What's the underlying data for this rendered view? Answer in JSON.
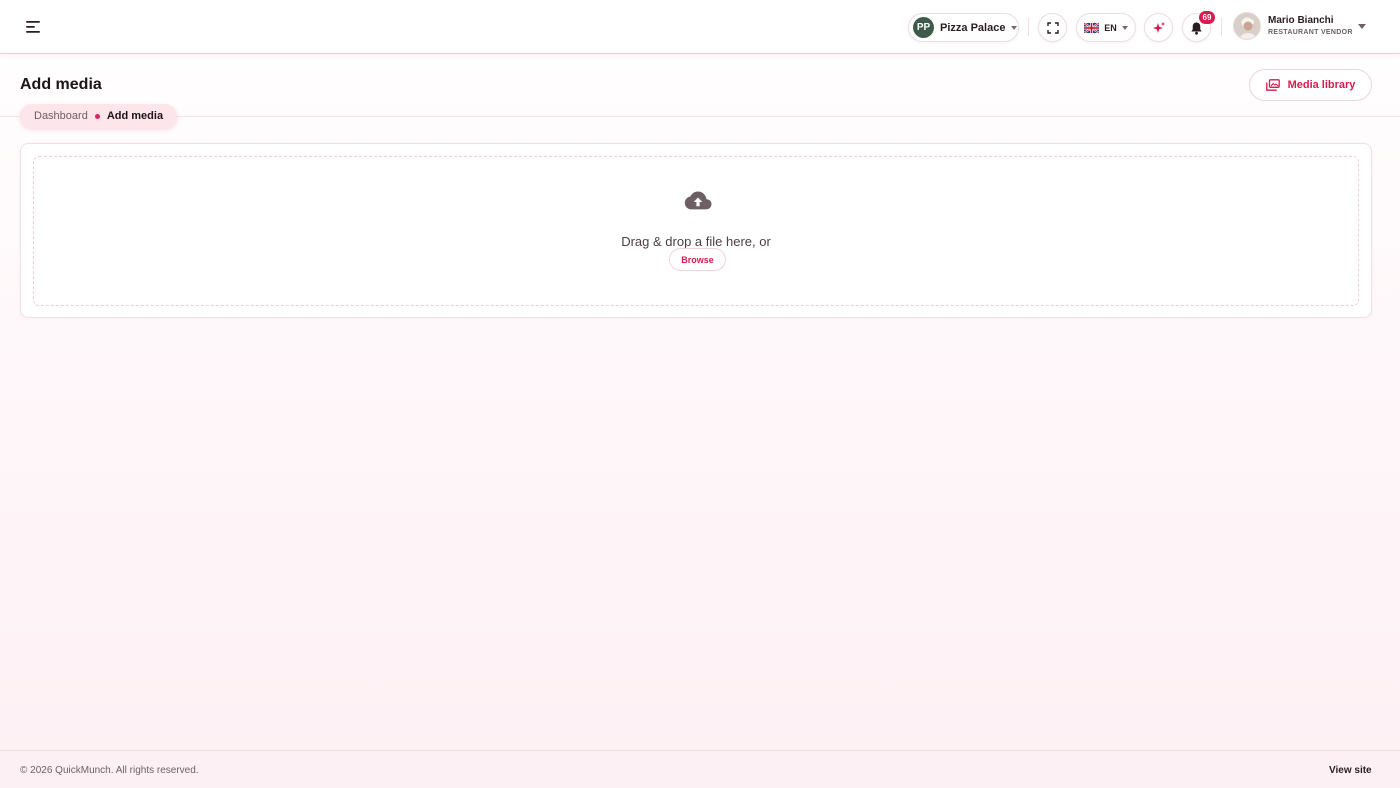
{
  "topbar": {
    "menu_icon": "hamburger-menu-icon",
    "restaurant": {
      "initials": "PP",
      "name": "Pizza Palace",
      "avatar_color": "#3d5a4a"
    },
    "fullscreen_icon": "fullscreen-icon",
    "language": {
      "flag_icon": "uk-flag-icon",
      "code": "EN"
    },
    "ai_icon": "sparkle-icon",
    "notifications": {
      "icon": "bell-icon",
      "count": "69"
    },
    "user": {
      "name": "Mario Bianchi",
      "role": "RESTAURANT VENDOR"
    }
  },
  "page": {
    "title": "Add media",
    "breadcrumb": [
      {
        "label": "Dashboard"
      },
      {
        "label": "Add media"
      }
    ],
    "media_library_button": {
      "label": "Media library",
      "icon": "gallery-icon"
    }
  },
  "uploader": {
    "icon": "cloud-upload-icon",
    "instruction": "Drag & drop a file here, or",
    "browse_label": "Browse"
  },
  "footer": {
    "copyright": "© 2026 QuickMunch. All rights reserved.",
    "view_site": "View site"
  },
  "colors": {
    "accent": "#d81b4f",
    "breadcrumb_bg": "#fde5ec",
    "text_dark": "#1d1418"
  }
}
